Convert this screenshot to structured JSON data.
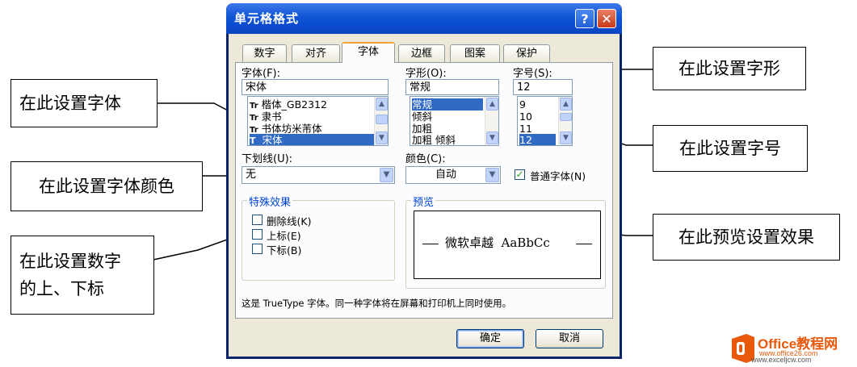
{
  "dialog": {
    "title": "单元格格式",
    "help_glyph": "?",
    "close_glyph": "✕",
    "tabs": [
      "数字",
      "对齐",
      "字体",
      "边框",
      "图案",
      "保护"
    ],
    "active_tab": "字体",
    "font_label": "字体(F):",
    "font_value": "宋体",
    "font_list": [
      "楷体_GB2312",
      "隶书",
      "书体坊米芾体",
      "宋体"
    ],
    "font_list_selected": "宋体",
    "style_label": "字形(O):",
    "style_value": "常规",
    "style_list": [
      "常规",
      "倾斜",
      "加粗",
      "加粗 倾斜"
    ],
    "style_list_selected": "常规",
    "size_label": "字号(S):",
    "size_value": "12",
    "size_list": [
      "9",
      "10",
      "11",
      "12"
    ],
    "size_list_selected": "12",
    "underline_label": "下划线(U):",
    "underline_value": "无",
    "color_label": "颜色(C):",
    "color_value": "自动",
    "normal_font_label": "普通字体(N)",
    "normal_font_checked": true,
    "effects_title": "特殊效果",
    "effects": [
      "删除线(K)",
      "上标(E)",
      "下标(B)"
    ],
    "preview_title": "预览",
    "preview_text": "微软卓越  AaBbCc",
    "info_text": "这是 TrueType 字体。同一种字体将在屏幕和打印机上同时使用。",
    "ok_label": "确定",
    "cancel_label": "取消"
  },
  "callouts": {
    "font": "在此设置字体",
    "style": "在此设置字形",
    "size": "在此设置字号",
    "color": "在此设置字体颜色",
    "preview": "在此预览设置效果",
    "subscript_line1": "在此设置数字",
    "subscript_line2": "的上、下标"
  },
  "watermark": {
    "brand": "Office教程网",
    "url": "www.office26.com",
    "url2": "www.exceljcw.com"
  },
  "colors": {
    "titlebar": "#0a4cd0",
    "dialog_face": "#ece9d8",
    "selection": "#316ac5",
    "tab_highlight": "#f3a23a",
    "watermark_orange": "#e8590c"
  }
}
